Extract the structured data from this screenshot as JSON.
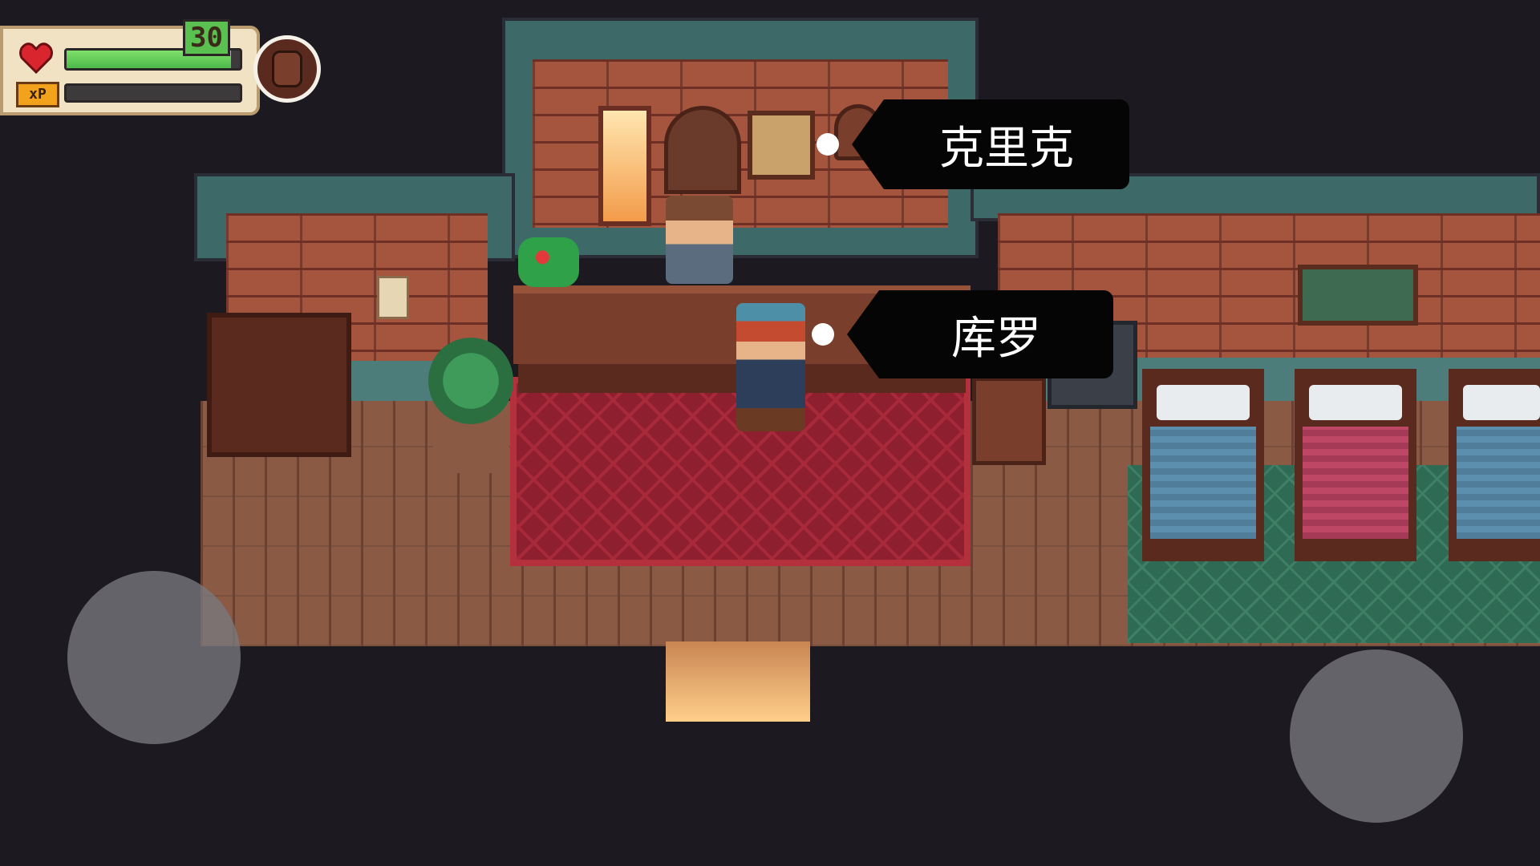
{
  "hud": {
    "level": "30",
    "hp_fraction": 0.95,
    "xp_fraction": 0.0,
    "xp_label": "xP",
    "icons": {
      "health": "heart-icon",
      "experience": "xp-icon",
      "portrait": "backpack-avatar"
    }
  },
  "npcs": [
    {
      "name": "克里克"
    },
    {
      "name": "库罗"
    }
  ],
  "controls": {
    "left_joystick": "movement-joystick",
    "right_joystick": "action-button"
  },
  "colors": {
    "background": "#1c1a20",
    "brick": "#a5553e",
    "wall_trim": "#3d6a69",
    "rug_red": "#8e1f2e",
    "rug_green": "#2f6a55",
    "hp_bar": "#5ac04f",
    "label_bg": "#050505"
  }
}
